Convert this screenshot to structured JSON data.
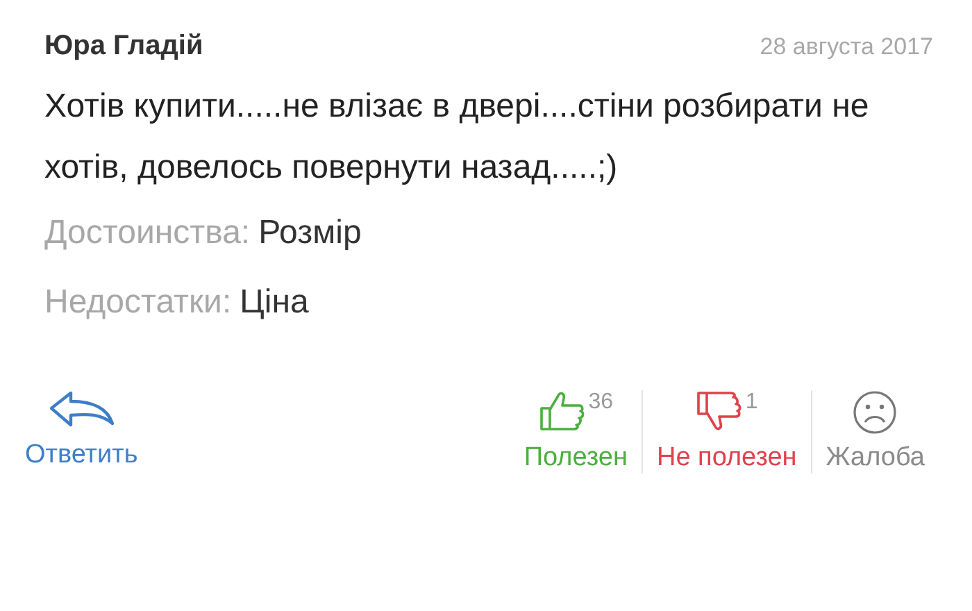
{
  "review": {
    "author": "Юра Гладій",
    "date": "28 августа 2017",
    "text": "Хотів купити.....не влізає в двері....стіни розбирати не хотів, довелось повернути назад.....;)",
    "pros": {
      "label": "Достоинства:",
      "value": "Розмір"
    },
    "cons": {
      "label": "Недостатки:",
      "value": "Ціна"
    }
  },
  "actions": [
    {
      "kind": "reply",
      "label": "Ответить"
    },
    {
      "kind": "helpful",
      "count": "36",
      "label": "Полезен"
    },
    {
      "kind": "unhelpful",
      "count": "1",
      "label": "Не полезен"
    },
    {
      "kind": "report",
      "label": "Жалоба"
    }
  ]
}
